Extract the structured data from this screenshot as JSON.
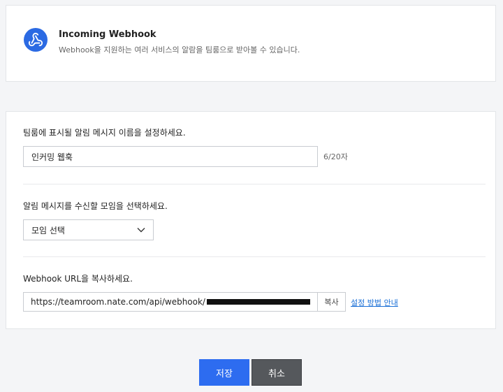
{
  "header": {
    "title": "Incoming Webhook",
    "subtitle": "Webhook을 지원하는 여러 서비스의 알람을 팀룸으로 받아볼 수 있습니다.",
    "logo_icon": "webhook-icon",
    "logo_color": "#2b6ae3"
  },
  "name_section": {
    "label": "팀룸에 표시될 알림 메시지 이름을 설정하세요.",
    "value": "인커밍 웹훅",
    "counter": "6/20자"
  },
  "group_section": {
    "label": "알림 메시지를 수신할 모임을 선택하세요.",
    "selected": "모임 선택",
    "dropdown_icon": "chevron-down-icon"
  },
  "url_section": {
    "label": "Webhook URL을 복사하세요.",
    "url_prefix": "https://teamroom.nate.com/api/webhook/",
    "copy_label": "복사",
    "guide_link": "설정 방법 안내"
  },
  "actions": {
    "save_label": "저장",
    "cancel_label": "취소",
    "save_color": "#2d6cf0",
    "cancel_color": "#55585c"
  }
}
